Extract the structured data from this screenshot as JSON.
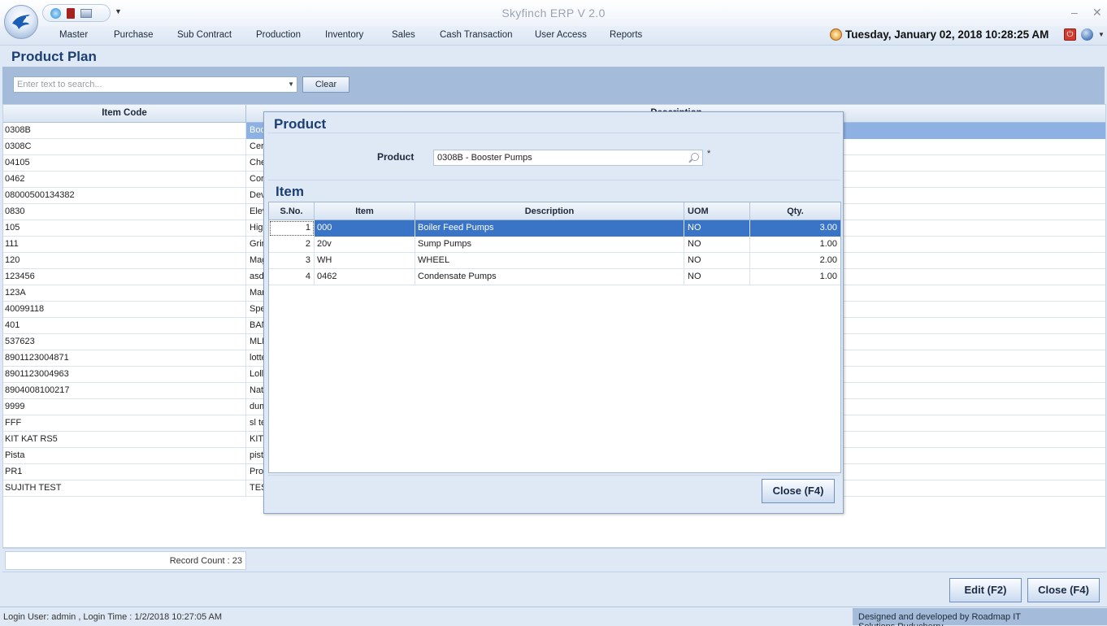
{
  "app": {
    "title": "Skyfinch  ERP V 2.0",
    "minimize": "–",
    "close": "✕"
  },
  "menu": {
    "items": [
      "Master",
      "Purchase",
      "Sub Contract",
      "Production",
      "Inventory",
      "Sales",
      "Cash Transaction",
      "User Access",
      "Reports"
    ],
    "datetime": "Tuesday, January 02, 2018 10:28:25 AM"
  },
  "page": {
    "title": "Product Plan",
    "search_placeholder": "Enter text to search...",
    "clear_label": "Clear"
  },
  "grid": {
    "columns": [
      "Item Code",
      "Description"
    ],
    "rows": [
      {
        "code": "0308B",
        "desc": "Boo"
      },
      {
        "code": "0308C",
        "desc": "Cer"
      },
      {
        "code": "04105",
        "desc": "Che"
      },
      {
        "code": "0462",
        "desc": "Cor"
      },
      {
        "code": "08000500134382",
        "desc": "Dev"
      },
      {
        "code": "0830",
        "desc": "Elev"
      },
      {
        "code": "105",
        "desc": "High"
      },
      {
        "code": "111",
        "desc": "Grin"
      },
      {
        "code": "120",
        "desc": "Mag"
      },
      {
        "code": "123456",
        "desc": "asd"
      },
      {
        "code": "123A",
        "desc": "Mar"
      },
      {
        "code": "40099118",
        "desc": "Spe"
      },
      {
        "code": "401",
        "desc": "BAN"
      },
      {
        "code": "537623",
        "desc": "MLL"
      },
      {
        "code": "8901123004871",
        "desc": "lotte"
      },
      {
        "code": "8901123004963",
        "desc": "Lolli"
      },
      {
        "code": "8904008100217",
        "desc": "Nat"
      },
      {
        "code": "9999",
        "desc": "dum"
      },
      {
        "code": "FFF",
        "desc": "sl te"
      },
      {
        "code": "KIT KAT RS5",
        "desc": "KIT"
      },
      {
        "code": "Pista",
        "desc": "pist"
      },
      {
        "code": "PR1",
        "desc": "Proc"
      },
      {
        "code": "SUJITH TEST",
        "desc": "TES"
      }
    ],
    "record_count": "Record Count : 23"
  },
  "actions": {
    "edit_label": "Edit (F2)",
    "close_label": "Close (F4)"
  },
  "status": {
    "login": "Login User: admin , Login Time : 1/2/2018 10:27:05 AM",
    "credit": "Designed and developed by Roadmap IT Solutions,Puducherry"
  },
  "modal": {
    "title": "Product",
    "product_label": "Product",
    "product_value": "0308B - Booster Pumps",
    "required_mark": "*",
    "item_title": "Item",
    "columns": [
      "S.No.",
      "Item",
      "Description",
      "UOM",
      "Qty."
    ],
    "rows": [
      {
        "sno": "1",
        "item": "000",
        "desc": "Boiler Feed Pumps",
        "uom": "NO",
        "qty": "3.00"
      },
      {
        "sno": "2",
        "item": "20v",
        "desc": "Sump Pumps",
        "uom": "NO",
        "qty": "1.00"
      },
      {
        "sno": "3",
        "item": "WH",
        "desc": "WHEEL",
        "uom": "NO",
        "qty": "2.00"
      },
      {
        "sno": "4",
        "item": "0462",
        "desc": "Condensate Pumps",
        "uom": "NO",
        "qty": "1.00"
      }
    ],
    "close_label": "Close (F4)"
  }
}
